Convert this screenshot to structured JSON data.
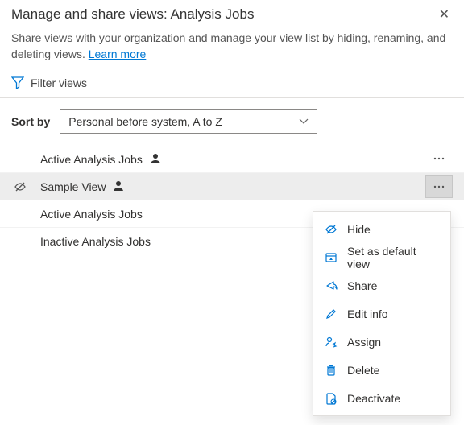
{
  "dialog": {
    "title": "Manage and share views: Analysis Jobs",
    "description": "Share views with your organization and manage your view list by hiding, renaming, and deleting views. ",
    "learn_more": "Learn more"
  },
  "filter": {
    "label": "Filter views"
  },
  "sort": {
    "label": "Sort by",
    "value": "Personal before system, A to Z"
  },
  "views": [
    {
      "name": "Active Analysis Jobs",
      "personal": true,
      "hidden": false,
      "selected": false,
      "has_menu": true
    },
    {
      "name": "Sample View",
      "personal": true,
      "hidden": true,
      "selected": true,
      "has_menu": true
    },
    {
      "name": "Active Analysis Jobs",
      "personal": false,
      "hidden": false,
      "selected": false,
      "has_menu": false
    },
    {
      "name": "Inactive Analysis Jobs",
      "personal": false,
      "hidden": false,
      "selected": false,
      "has_menu": false
    }
  ],
  "context_menu": [
    {
      "icon": "hide",
      "label": "Hide",
      "color": "#0078d4"
    },
    {
      "icon": "default",
      "label": "Set as default view",
      "color": "#0078d4"
    },
    {
      "icon": "share",
      "label": "Share",
      "color": "#0078d4"
    },
    {
      "icon": "edit",
      "label": "Edit info",
      "color": "#0078d4"
    },
    {
      "icon": "assign",
      "label": "Assign",
      "color": "#0078d4"
    },
    {
      "icon": "delete",
      "label": "Delete",
      "color": "#0078d4"
    },
    {
      "icon": "deactivate",
      "label": "Deactivate",
      "color": "#0078d4"
    }
  ],
  "colors": {
    "link": "#0078d4"
  }
}
